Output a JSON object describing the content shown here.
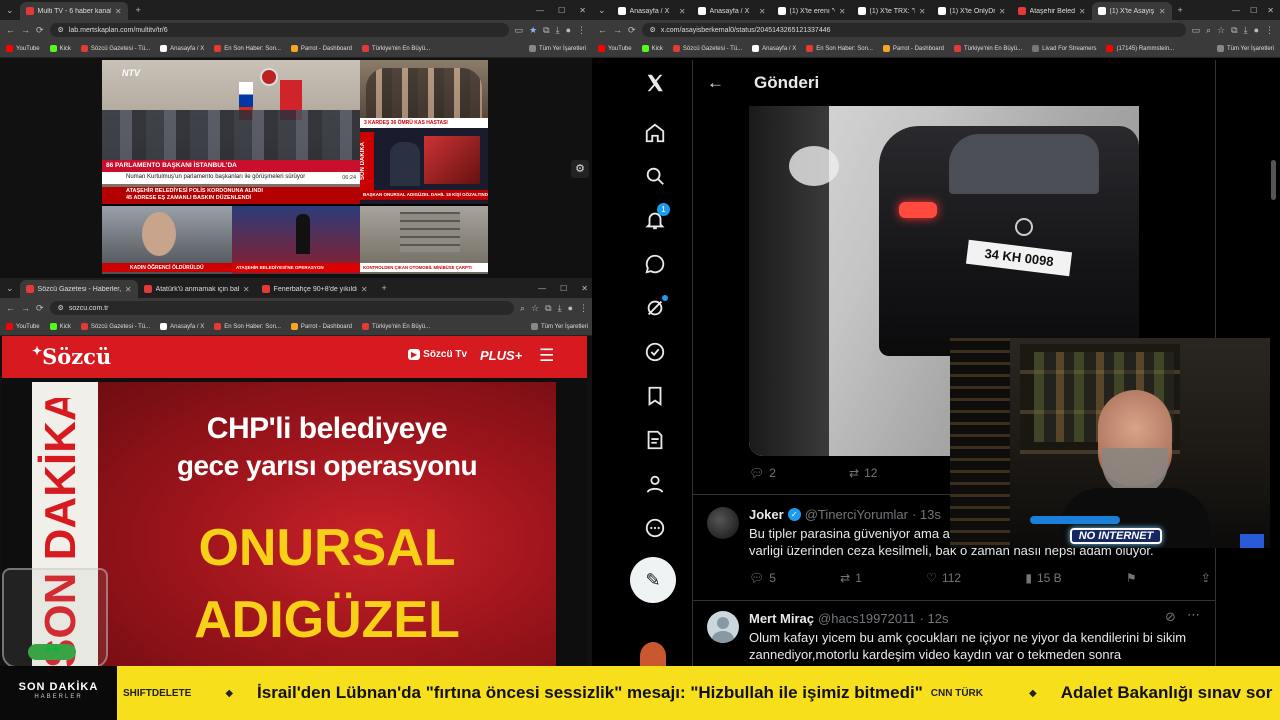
{
  "multitv": {
    "tabs": [
      {
        "label": "Multi TV - 6 haber kanalını aynı",
        "active": true,
        "color": "#e53935"
      }
    ],
    "url": "lab.mertskaplan.com/multitv/tr/6",
    "bookmarks": [
      "YouTube",
      "Kick",
      "Sözcü Gazetesi - Tü...",
      "Anasayfa / X",
      "En Son Haber: Son...",
      "Parrot - Dashboard",
      "Türkiye'nin En Büyü...",
      "Tüm Yer İşaretleri"
    ],
    "ntv_lower": "86 PARLAMENTO BAŞKANI İSTANBUL'DA",
    "ntv_sub": "Numan Kurtulmuş'un parlamento başkanları ile görüşmeleri sürüyor",
    "ntv_logo": "NTV",
    "tr_lower1": "ATAŞEHİR BELEDİYESİ POLİS KORDONUNA ALINDI",
    "tr_lower2": "45 ADRESE EŞ ZAMANLI BASKIN DÜZENLENDİ",
    "tr_time": "06:24",
    "cnn_caption": "3 KARDEŞ 36 ÖMRÜ KAS HASTASI",
    "sondakika_vert": "SON DAKİKA",
    "halk_caption": "BAŞKAN ONURSAL ADIGÜZEL DAHİL 18 KİŞİ GÖZALTINDA",
    "bottom_left_caption": "KADIN ÖĞRENCİ ÖLDÜRÜLDÜ",
    "bottom_mid_caption": "ATAŞEHİR BELEDİYESİ'NE OPERASYON",
    "bottom_right_caption": "KONTROLDEN ÇIKAN OTOMOBİL MİNİBÜSE ÇARPTI"
  },
  "sozcu_window": {
    "tabs": [
      {
        "label": "Sözcü Gazetesi - Haberler, son",
        "active": true,
        "color": "#e53935"
      },
      {
        "label": "Atatürk'ü anmamak için bahane",
        "active": false,
        "color": "#e53935"
      },
      {
        "label": "Fenerbahçe 90+8'de yıkıldı! De",
        "active": false,
        "color": "#e53935"
      }
    ],
    "url": "sozcu.com.tr",
    "bookmarks": [
      "YouTube",
      "Kick",
      "Sözcü Gazetesi - Tü...",
      "Anasayfa / X",
      "En Son Haber: Son...",
      "Parrot - Dashboard",
      "Türkiye'nin En Büyü...",
      "Tüm Yer İşaretleri"
    ],
    "logo": "Sözcü",
    "tv_label": "Sözcü Tv",
    "plus_label": "PLUS+",
    "headline_top": "CHP'li belediyeye",
    "headline_mid": "gece yarısı operasyonu",
    "headline_name1": "ONURSAL",
    "headline_name2": "ADIGÜZEL",
    "side_word": "SON DAKİKA"
  },
  "x_window": {
    "tabs": [
      {
        "label": "Anasayfa / X",
        "active": false,
        "color": "#ffffff"
      },
      {
        "label": "Anasayfa / X",
        "active": false,
        "color": "#ffffff"
      },
      {
        "label": "(1) X'te erenı \"Ö",
        "active": false,
        "color": "#ffffff"
      },
      {
        "label": "(1) X'te TRX: \"Bi",
        "active": false,
        "color": "#ffffff"
      },
      {
        "label": "(1) X'te OnlyDra",
        "active": false,
        "color": "#ffffff"
      },
      {
        "label": "Ataşehir Belediye",
        "active": false,
        "color": "#e53935"
      },
      {
        "label": "(1) X'te Asayiş B",
        "active": true,
        "color": "#ffffff"
      }
    ],
    "url": "x.com/asayisberkemal0/status/2045143265121337446",
    "bookmarks": [
      "YouTube",
      "Kick",
      "Sözcü Gazetesi - Tü...",
      "Anasayfa / X",
      "En Son Haber: Son...",
      "Parrot - Dashboard",
      "Türkiye'nin En Büyü...",
      "Livad For Streamers",
      "(17145) Rammstein...",
      "Tüm Yer İşaretleri"
    ],
    "page_title": "Gönderi",
    "notif_count": "1",
    "plate": "34 KH 0098",
    "main_post": {
      "replies": "2",
      "reposts": "12"
    },
    "replies": [
      {
        "name": "Joker",
        "handle": "@TinerciYorumlar",
        "time": "· 13s",
        "text1": "Bu tipler parasina güveniyor ama asıl",
        "text2": "varligi üzerinden ceza kesilmeli, bak o zaman nasıl hepsi adam oluyor.",
        "stats": {
          "replies": "5",
          "reposts": "1",
          "likes": "112",
          "views": "15 B"
        }
      },
      {
        "name": "Mert Miraç",
        "handle": "@hacs19972011",
        "time": "· 12s",
        "text1": "Olum kafayı yicem bu amk çocukları ne içiyor ne yiyor da kendilerini bi sikim",
        "text2": "zannediyor,motorlu kardeşim video kaydın var o tekmeden sonra"
      }
    ]
  },
  "webcam": {
    "neon_sign": "NO INTERNET"
  },
  "ticker": {
    "logo_line1": "SON DAKİKA",
    "logo_line2": "HABERLER",
    "source1": "SHIFTDELETE",
    "headline1": "İsrail'den Lübnan'da \"fırtına öncesi sessizlik\" mesajı: \"Hizbullah ile işimiz bitmedi\"",
    "source2": "CNN TÜRK",
    "headline2": "Adalet Bakanlığı sınav sor"
  },
  "colors": {
    "sozcu_red": "#d71920",
    "x_blue": "#1d9bf0",
    "ticker_yellow": "#f7e01b"
  }
}
